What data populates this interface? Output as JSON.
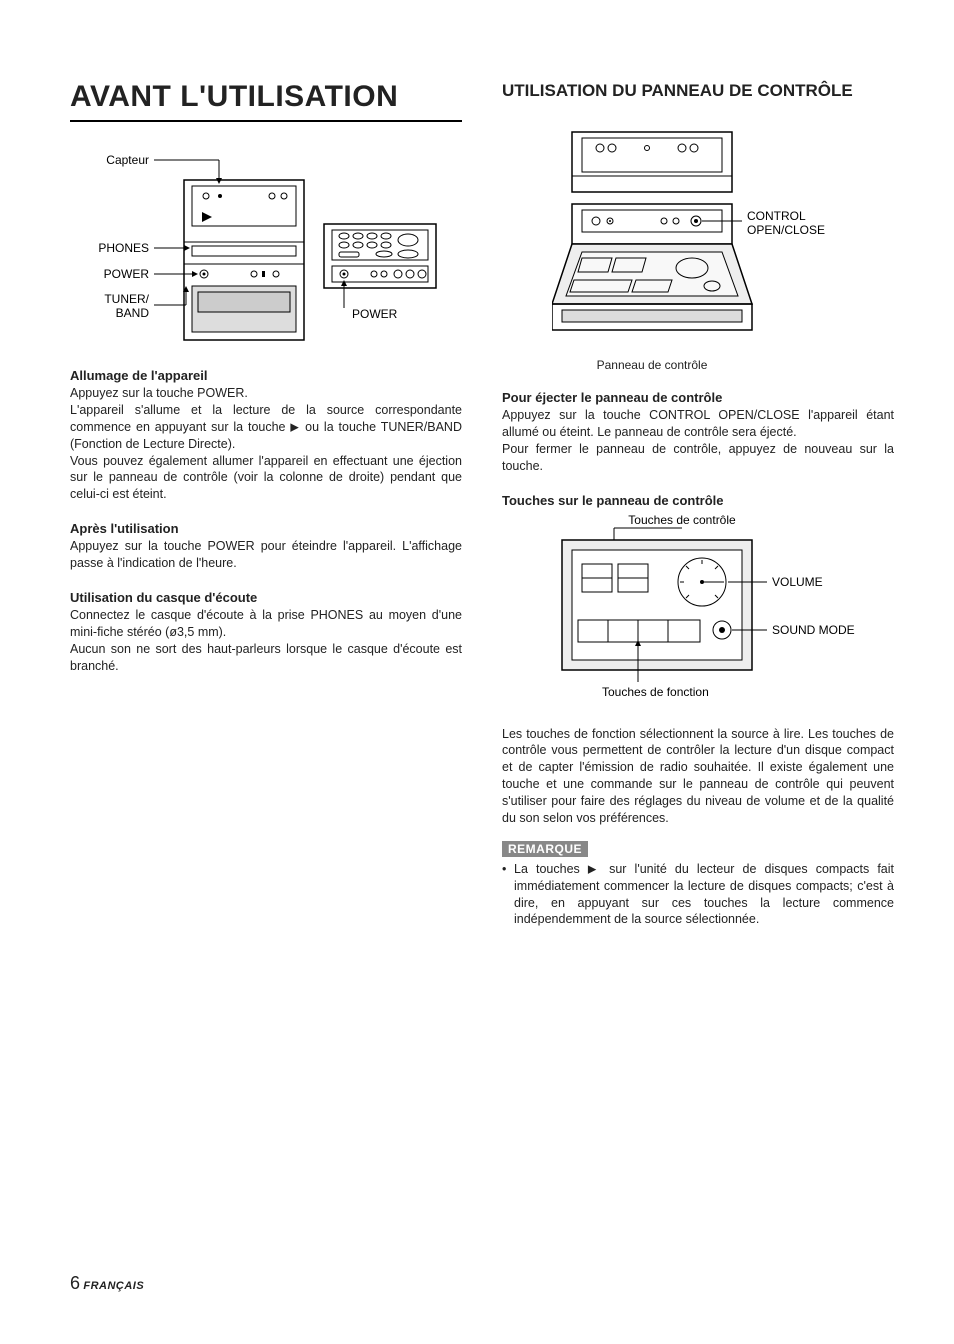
{
  "left": {
    "main_title": "AVANT L'UTILISATION",
    "diagram1": {
      "capteur": "Capteur",
      "phones": "PHONES",
      "power_left": "POWER",
      "tuner_band": "TUNER/\nBAND",
      "power_right": "POWER"
    },
    "sec1": {
      "heading": "Allumage de l'appareil",
      "p1": "Appuyez sur la touche POWER.",
      "p2a": "L'appareil s'allume et la lecture de la source correspondante commence en appuyant sur la touche ",
      "p2b": " ou la touche TUNER/BAND (Fonction de Lecture Directe).",
      "p3": "Vous pouvez également allumer l'appareil en effectuant une éjection sur le panneau de contrôle (voir la colonne de droite) pendant que celui-ci est éteint."
    },
    "sec2": {
      "heading": "Après l'utilisation",
      "p1": "Appuyez sur la touche POWER pour éteindre l'appareil. L'affichage passe à l'indication de l'heure."
    },
    "sec3": {
      "heading": "Utilisation du casque d'écoute",
      "p1": "Connectez le casque d'écoute à la prise PHONES au moyen d'une mini-fiche stéréo (ø3,5 mm).",
      "p2": "Aucun son ne sort des haut-parleurs lorsque le casque d'écoute est branché."
    }
  },
  "right": {
    "section_title": "UTILISATION DU PANNEAU DE CONTRÔLE",
    "diagram2": {
      "control_open": "CONTROL\nOPEN/CLOSE",
      "caption": "Panneau de contrôle"
    },
    "sec1": {
      "heading": "Pour éjecter le panneau de contrôle",
      "p1": "Appuyez sur la touche CONTROL OPEN/CLOSE l'appareil étant allumé ou éteint. Le panneau de contrôle sera éjecté.",
      "p2": "Pour fermer le panneau de contrôle, appuyez de nouveau sur la touche."
    },
    "sec2": {
      "heading": "Touches sur le panneau de contrôle"
    },
    "diagram3": {
      "touches_controle": "Touches de contrôle",
      "volume": "VOLUME",
      "sound_mode": "SOUND MODE",
      "touches_fonction": "Touches de fonction"
    },
    "p_functions": "Les touches de fonction sélectionnent la source à lire. Les touches de contrôle vous permettent de contrôler la lecture d'un disque compact et de capter l'émission de radio souhaitée. Il existe également une touche et une commande sur le panneau de contrôle qui peuvent s'utiliser pour faire des réglages du niveau de volume et de la qualité du son selon vos préférences.",
    "remark_label": "REMARQUE",
    "remark_item_a": "La touches ",
    "remark_item_b": " sur l'unité du lecteur de disques compacts fait immédiatement commencer la lecture de disques compacts; c'est à dire, en appuyant sur ces touches la lecture commence indépendemment de la source sélectionnée."
  },
  "footer": {
    "page": "6",
    "lang": "FRANÇAIS"
  }
}
